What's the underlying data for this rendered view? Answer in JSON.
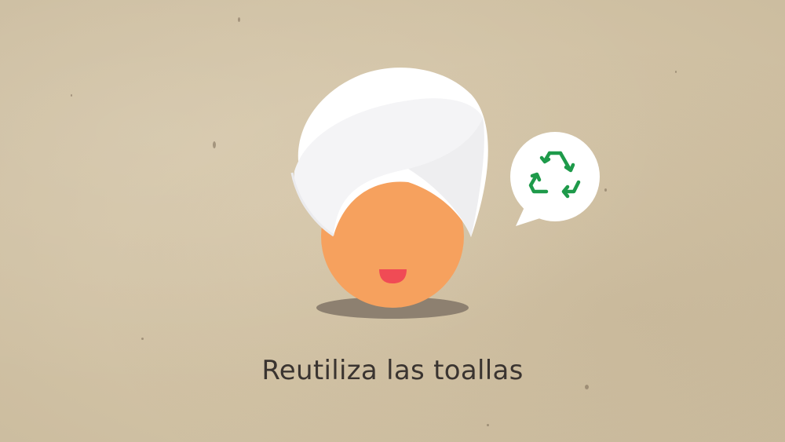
{
  "caption": "Reutiliza las toallas",
  "icons": {
    "figure": "towel-head-person-icon",
    "bubble_symbol": "recycle-icon"
  },
  "colors": {
    "background": "#d7c7a8",
    "towel": "#ffffff",
    "towel_shade": "#eeeef0",
    "face": "#f6a15e",
    "mouth": "#f04b55",
    "shadow": "#8d8070",
    "bubble": "#ffffff",
    "recycle": "#1e9a4a",
    "text": "#3a3430"
  }
}
